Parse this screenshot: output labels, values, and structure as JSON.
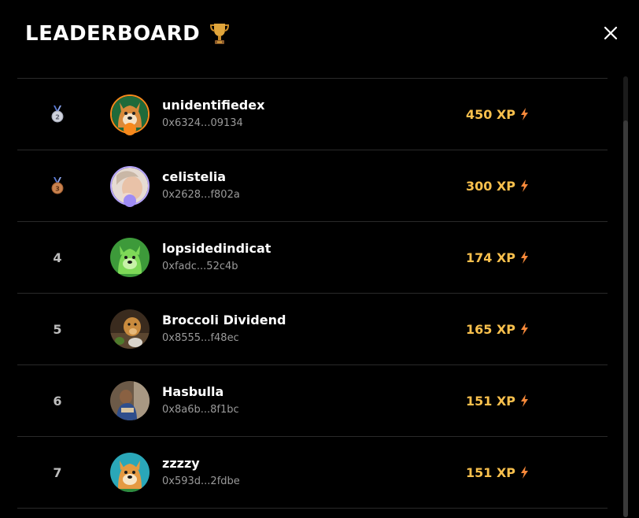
{
  "header": {
    "title": "LEADERBOARD",
    "trophy_icon": "trophy-icon",
    "close_icon": "close-icon"
  },
  "colors": {
    "xp": "#f9c04d",
    "bolt": "#f7893a",
    "divider": "#2a2a2a"
  },
  "rows": [
    {
      "rank": "",
      "rank_icon": "silver-medal-icon",
      "name": "unidentifiedex",
      "address": "0x6324...09134",
      "xp": "450 XP",
      "avatar": "shiba-dog-avatar"
    },
    {
      "rank": "",
      "rank_icon": "bronze-medal-icon",
      "name": "celistelia",
      "address": "0x2628...f802a",
      "xp": "300 XP",
      "avatar": "person-avatar"
    },
    {
      "rank": "4",
      "name": "lopsidedindicat",
      "address": "0xfadc...52c4b",
      "xp": "174 XP",
      "avatar": "green-doge-avatar"
    },
    {
      "rank": "5",
      "name": "Broccoli Dividend",
      "address": "0x8555...f48ec",
      "xp": "165 XP",
      "avatar": "dog-photo-avatar"
    },
    {
      "rank": "6",
      "name": "Hasbulla",
      "address": "0x8a6b...8f1bc",
      "xp": "151 XP",
      "avatar": "person-photo-avatar"
    },
    {
      "rank": "7",
      "name": "zzzzy",
      "address": "0x593d...2fdbe",
      "xp": "151 XP",
      "avatar": "shiba-dog-avatar"
    }
  ]
}
